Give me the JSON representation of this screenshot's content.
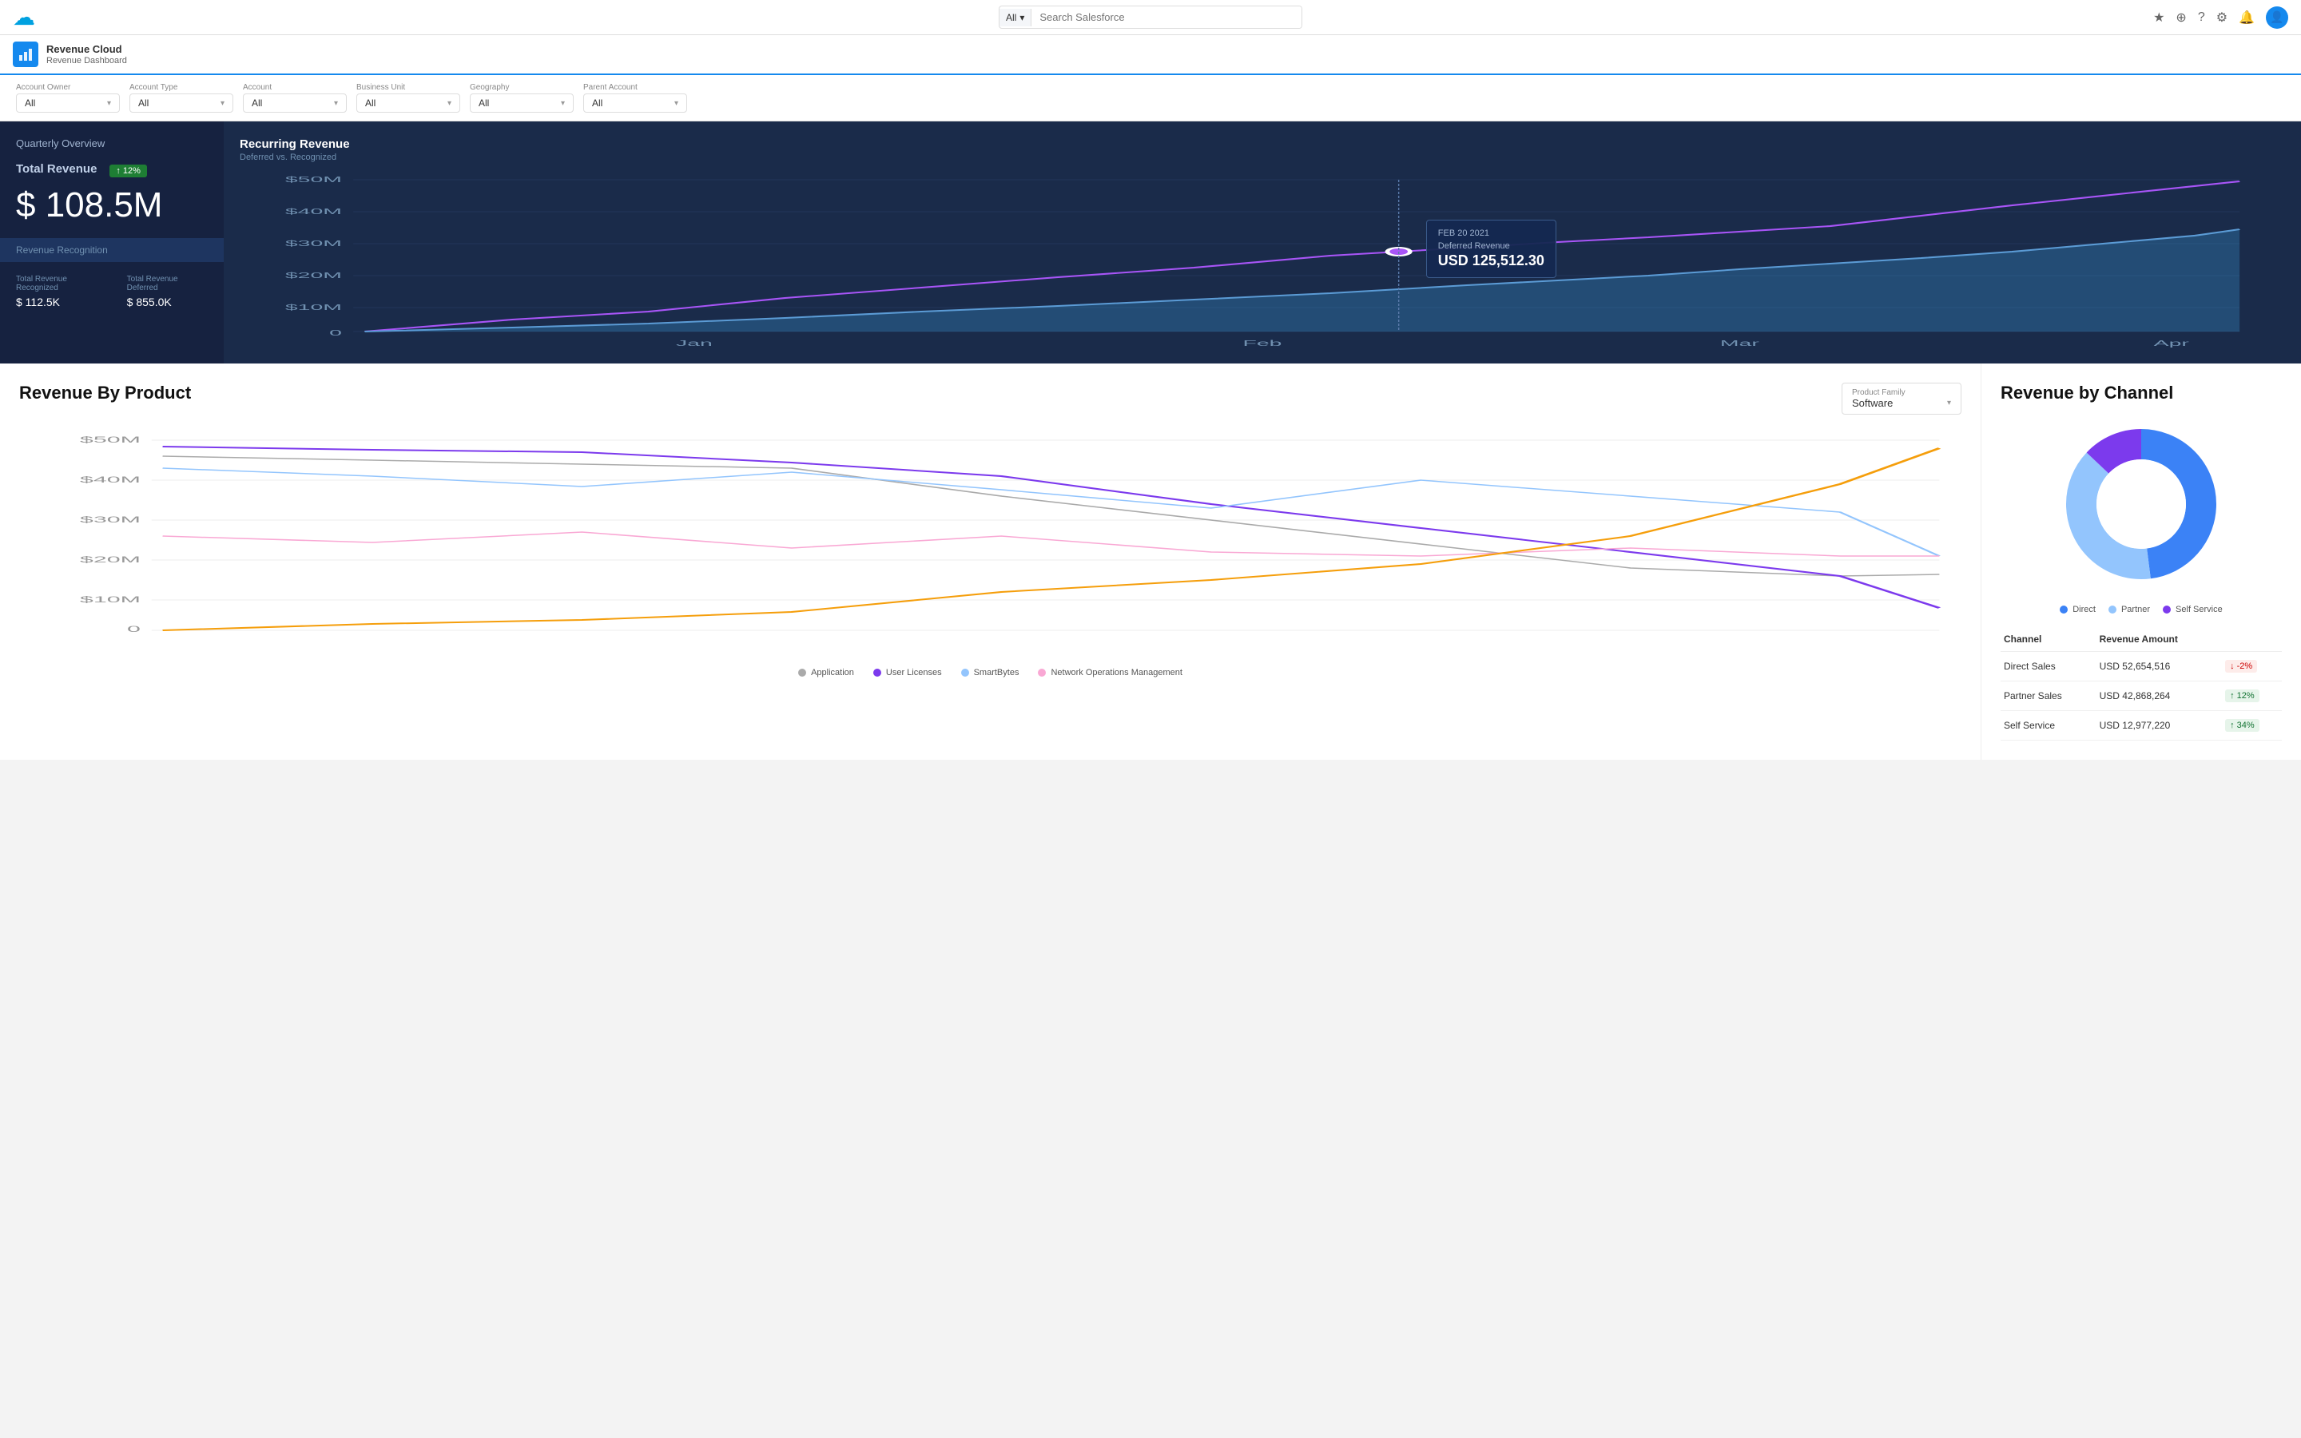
{
  "topNav": {
    "logo": "☁",
    "searchScope": "All",
    "searchPlaceholder": "Search Salesforce",
    "icons": [
      "★",
      "+",
      "?",
      "⚙",
      "🔔",
      "👤"
    ]
  },
  "appBar": {
    "icon": "📊",
    "appName": "Revenue Cloud",
    "dashboardName": "Revenue Dashboard"
  },
  "filters": [
    {
      "label": "Account Owner",
      "value": "All"
    },
    {
      "label": "Account Type",
      "value": "All"
    },
    {
      "label": "Account",
      "value": "All"
    },
    {
      "label": "Business Unit",
      "value": "All"
    },
    {
      "label": "Geography",
      "value": "All"
    },
    {
      "label": "Parent Account",
      "value": "All"
    }
  ],
  "quarterly": {
    "sectionTitle": "Quarterly Overview",
    "totalRevenueLabel": "Total Revenue",
    "totalRevenueValue": "$ 108.5M",
    "badge": "12%",
    "revenueRecognition": "Revenue Recognition",
    "totalRecognizedLabel": "Total Revenue Recognized",
    "totalRecognizedValue": "$ 112.5K",
    "totalDeferredLabel": "Total Revenue Deferred",
    "totalDeferredValue": "$ 855.0K"
  },
  "recurringRevenue": {
    "title": "Recurring Revenue",
    "subtitle": "Deferred vs. Recognized",
    "yLabels": [
      "$50M",
      "$40M",
      "$30M",
      "$20M",
      "$10M",
      "0"
    ],
    "xLabels": [
      "Jan",
      "Feb",
      "Mar",
      "Apr"
    ],
    "tooltip": {
      "date": "FEB 20 2021",
      "label": "Deferred Revenue",
      "value": "USD 125,512.30"
    }
  },
  "revenueByProduct": {
    "title": "Revenue By Product",
    "productFilterLabel": "Product Family",
    "productFilterValue": "Software",
    "yLabels": [
      "$50M",
      "$40M",
      "$30M",
      "$20M",
      "$10M",
      "0"
    ],
    "legend": [
      {
        "label": "Application",
        "color": "#aaa"
      },
      {
        "label": "User Licenses",
        "color": "#7c3aed"
      },
      {
        "label": "SmartBytes",
        "color": "#93c5fd"
      },
      {
        "label": "Network Operations Management",
        "color": "#f9a8d4"
      }
    ]
  },
  "revenueByChannel": {
    "title": "Revenue by Channel",
    "donutLegend": [
      {
        "label": "Direct",
        "color": "#3b82f6"
      },
      {
        "label": "Partner",
        "color": "#93c5fd"
      },
      {
        "label": "Self Service",
        "color": "#7c3aed"
      }
    ],
    "tableHeaders": [
      "Channel",
      "Revenue Amount"
    ],
    "tableRows": [
      {
        "channel": "Direct Sales",
        "amount": "USD 52,654,516",
        "badge": "-2%",
        "badgeType": "down"
      },
      {
        "channel": "Partner Sales",
        "amount": "USD 42,868,264",
        "badge": "12%",
        "badgeType": "up"
      },
      {
        "channel": "Self Service",
        "amount": "USD 12,977,220",
        "badge": "34%",
        "badgeType": "up"
      }
    ]
  }
}
